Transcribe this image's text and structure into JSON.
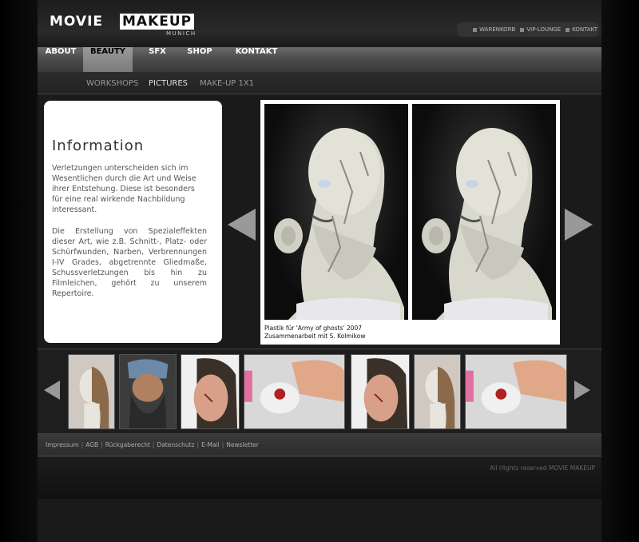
{
  "logo": {
    "word1": "MOVIE",
    "word2": "MAKEUP",
    "sub": "MUNICH"
  },
  "top_links": [
    {
      "label": "WARENKORB",
      "icon": "square-bullet-icon"
    },
    {
      "label": "VIP-LOUNGE",
      "icon": "square-bullet-icon"
    },
    {
      "label": "KONTAKT",
      "icon": "square-bullet-icon"
    }
  ],
  "nav": {
    "items": [
      {
        "label": "ABOUT"
      },
      {
        "label": "BEAUTY",
        "active": true
      },
      {
        "label": "SFX"
      },
      {
        "label": "SHOP"
      },
      {
        "label": "KONTAKT"
      }
    ]
  },
  "subnav": {
    "items": [
      {
        "label": "WORKSHOPS"
      },
      {
        "label": "PICTURES",
        "active": true
      },
      {
        "label": "MAKE-UP 1X1"
      }
    ]
  },
  "info": {
    "title": "Information",
    "paragraph1": "Verletzungen unterscheiden sich im Wesentlichen durch die Art und Weise ihrer Entstehung. Diese ist besonders für eine real wirkende Nachbildung interessant.",
    "paragraph2": "Die Erstellung von Spezialeffekten dieser Art, wie z.B. Schnitt-, Platz- oder Schürfwunden, Narben, Verbrennungen I-IV Grades, abgetrennte Gliedmaße, Schussverletzungen bis hin zu Filmleichen, gehört zu unserem Repertoire."
  },
  "main_image": {
    "caption_line1": "Plastik für 'Army of ghosts' 2007",
    "caption_line2": "Zusammenarbeit mit S. Kolmikow"
  },
  "arrows": {
    "prev": "arrow-left-icon",
    "next": "arrow-right-icon"
  },
  "footer": {
    "links": [
      "Impressum",
      "AGB",
      "Rückgaberecht",
      "Datenschutz",
      "E-Mail",
      "Newsletter"
    ],
    "copyright": "All ritghts reserved MOVIE MAKEUP"
  },
  "colors": {
    "background": "#000000",
    "panel": "#2a2a2a",
    "nav": "#5a5a5a",
    "active_tab": "#8a8a8a",
    "info_box": "#ffffff"
  }
}
